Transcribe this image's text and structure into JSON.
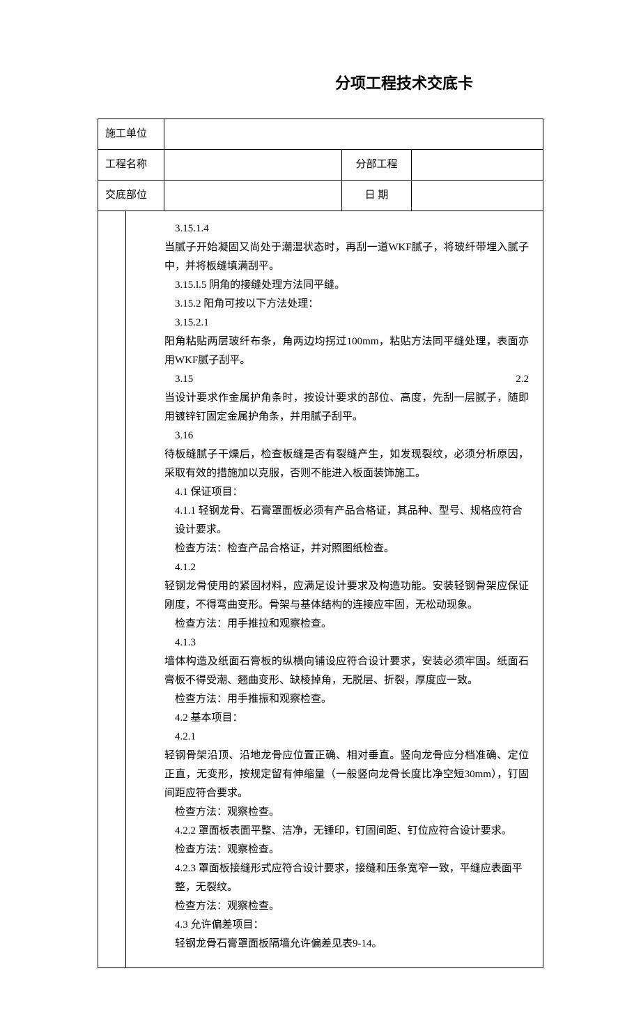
{
  "title": "分项工程技术交底卡",
  "header": {
    "row1_label": "施工单位",
    "row1_value": "",
    "row2_label": "工程名称",
    "row2_value": "",
    "row2_label2": "分部工程",
    "row2_value2": "",
    "row3_label": "交底部位",
    "row3_value": "",
    "row3_label2": "日 期",
    "row3_value2": ""
  },
  "content": {
    "p1_num": "3.15.1.4",
    "p1_text": "当腻子开始凝固又尚处于潮湿状态时，再刮一道WKF腻子，将玻纤带埋入腻子中，并将板缝填满刮平。",
    "p2_text": "3.15.l.5  阴角的接缝处理方法同平缝。",
    "p3_text": "3.15.2  阳角可按以下方法处理：",
    "p4_num": "3.15.2.1",
    "p4_text": "阳角粘贴两层玻纤布条，角两边均拐过100mm，粘贴方法同平缝处理，表面亦用WKF腻子刮平。",
    "p5_num_left": "3.15",
    "p5_num_right": "2.2",
    "p5_text": "当设计要求作金属护角条时，按设计要求的部位、高度，先刮一层腻子，随即用镀锌钉固定金属护角条，并用腻子刮平。",
    "p6_num": "3.16",
    "p6_text": "待板缝腻子干燥后，检查板缝是否有裂缝产生，如发现裂纹，必须分析原因，采取有效的措施加以克服，否则不能进入板面装饰施工。",
    "p7_text": "4.1  保证项目：",
    "p8_text": "4.1.1  轻钢龙骨、石膏罩面板必须有产品合格证，其品种、型号、规格应符合设计要求。",
    "p9_text": "检查方法：检查产品合格证，并对照图纸检查。",
    "p10_num": "4.1.2",
    "p10_text": "轻钢龙骨使用的紧固材料，应满足设计要求及构造功能。安装轻钢骨架应保证刚度，不得弯曲变形。骨架与基体结构的连接应牢固，无松动现象。",
    "p11_text": "检查方法：用手推拉和观察检查。",
    "p12_num": "4.1.3",
    "p12_text": "墙体构造及纸面石膏板的纵横向铺设应符合设计要求，安装必须牢固。纸面石膏板不得受潮、翘曲变形、缺棱掉角，无脱层、折裂，厚度应一致。",
    "p13_text": "检查方法：用手推振和观察检查。",
    "p14_text": "4.2  基本项目：",
    "p15_num": "4.2.1",
    "p15_text": "轻钢骨架沿顶、沿地龙骨应位置正确、相对垂直。竖向龙骨应分档准确、定位正直，无变形，按规定留有伸缩量（一般竖向龙骨长度比净空短30mm），钉固间距应符合要求。",
    "p16_text": "检查方法：观察检查。",
    "p17_text": "4.2.2  罩面板表面平整、洁净，无锤印，钉固间距、钉位应符合设计要求。",
    "p18_text": "检查方法：观察检查。",
    "p19_text": "4.2.3  罩面板接缝形式应符合设计要求，接缝和压条宽窄一致，平缝应表面平整，无裂纹。",
    "p20_text": "检查方法：观察检查。",
    "p21_text": "4.3  允许偏差项目：",
    "p22_text": "轻钢龙骨石膏罩面板隔墙允许偏差见表9-14。"
  }
}
